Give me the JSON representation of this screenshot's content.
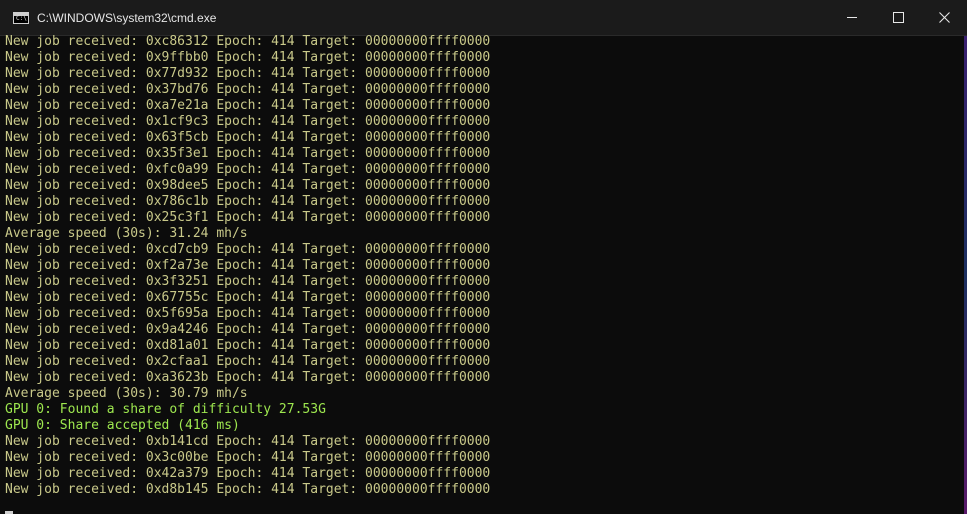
{
  "window": {
    "title": "C:\\WINDOWS\\system32\\cmd.exe",
    "icon_glyph": "C:\\",
    "controls": [
      "minimize-icon",
      "maximize-icon",
      "close-icon"
    ]
  },
  "console": {
    "lines": [
      {
        "text": "New job received: 0xc86312 Epoch: 414 Target: 00000000ffff0000",
        "kind": "yellow"
      },
      {
        "text": "New job received: 0x9ffbb0 Epoch: 414 Target: 00000000ffff0000",
        "kind": "yellow"
      },
      {
        "text": "New job received: 0x77d932 Epoch: 414 Target: 00000000ffff0000",
        "kind": "yellow"
      },
      {
        "text": "New job received: 0x37bd76 Epoch: 414 Target: 00000000ffff0000",
        "kind": "yellow"
      },
      {
        "text": "New job received: 0xa7e21a Epoch: 414 Target: 00000000ffff0000",
        "kind": "yellow"
      },
      {
        "text": "New job received: 0x1cf9c3 Epoch: 414 Target: 00000000ffff0000",
        "kind": "yellow"
      },
      {
        "text": "New job received: 0x63f5cb Epoch: 414 Target: 00000000ffff0000",
        "kind": "yellow"
      },
      {
        "text": "New job received: 0x35f3e1 Epoch: 414 Target: 00000000ffff0000",
        "kind": "yellow"
      },
      {
        "text": "New job received: 0xfc0a99 Epoch: 414 Target: 00000000ffff0000",
        "kind": "yellow"
      },
      {
        "text": "New job received: 0x98dee5 Epoch: 414 Target: 00000000ffff0000",
        "kind": "yellow"
      },
      {
        "text": "New job received: 0x786c1b Epoch: 414 Target: 00000000ffff0000",
        "kind": "yellow"
      },
      {
        "text": "New job received: 0x25c3f1 Epoch: 414 Target: 00000000ffff0000",
        "kind": "yellow"
      },
      {
        "text": "Average speed (30s): 31.24 mh/s",
        "kind": "yellow"
      },
      {
        "text": "New job received: 0xcd7cb9 Epoch: 414 Target: 00000000ffff0000",
        "kind": "yellow"
      },
      {
        "text": "New job received: 0xf2a73e Epoch: 414 Target: 00000000ffff0000",
        "kind": "yellow"
      },
      {
        "text": "New job received: 0x3f3251 Epoch: 414 Target: 00000000ffff0000",
        "kind": "yellow"
      },
      {
        "text": "New job received: 0x67755c Epoch: 414 Target: 00000000ffff0000",
        "kind": "yellow"
      },
      {
        "text": "New job received: 0x5f695a Epoch: 414 Target: 00000000ffff0000",
        "kind": "yellow"
      },
      {
        "text": "New job received: 0x9a4246 Epoch: 414 Target: 00000000ffff0000",
        "kind": "yellow"
      },
      {
        "text": "New job received: 0xd81a01 Epoch: 414 Target: 00000000ffff0000",
        "kind": "yellow"
      },
      {
        "text": "New job received: 0x2cfaa1 Epoch: 414 Target: 00000000ffff0000",
        "kind": "yellow"
      },
      {
        "text": "New job received: 0xa3623b Epoch: 414 Target: 00000000ffff0000",
        "kind": "yellow"
      },
      {
        "text": "Average speed (30s): 30.79 mh/s",
        "kind": "yellow"
      },
      {
        "text": "GPU 0: Found a share of difficulty 27.53G",
        "kind": "green"
      },
      {
        "text": "GPU 0: Share accepted (416 ms)",
        "kind": "green"
      },
      {
        "text": "New job received: 0xb141cd Epoch: 414 Target: 00000000ffff0000",
        "kind": "yellow"
      },
      {
        "text": "New job received: 0x3c00be Epoch: 414 Target: 00000000ffff0000",
        "kind": "yellow"
      },
      {
        "text": "New job received: 0x42a379 Epoch: 414 Target: 00000000ffff0000",
        "kind": "yellow"
      },
      {
        "text": "New job received: 0xd8b145 Epoch: 414 Target: 00000000ffff0000",
        "kind": "yellow"
      }
    ]
  },
  "colors": {
    "background": "#0c0c0c",
    "titlebar": "#1b1b1b",
    "text_yellow": "#c9c98a",
    "text_green": "#9ee84f"
  }
}
